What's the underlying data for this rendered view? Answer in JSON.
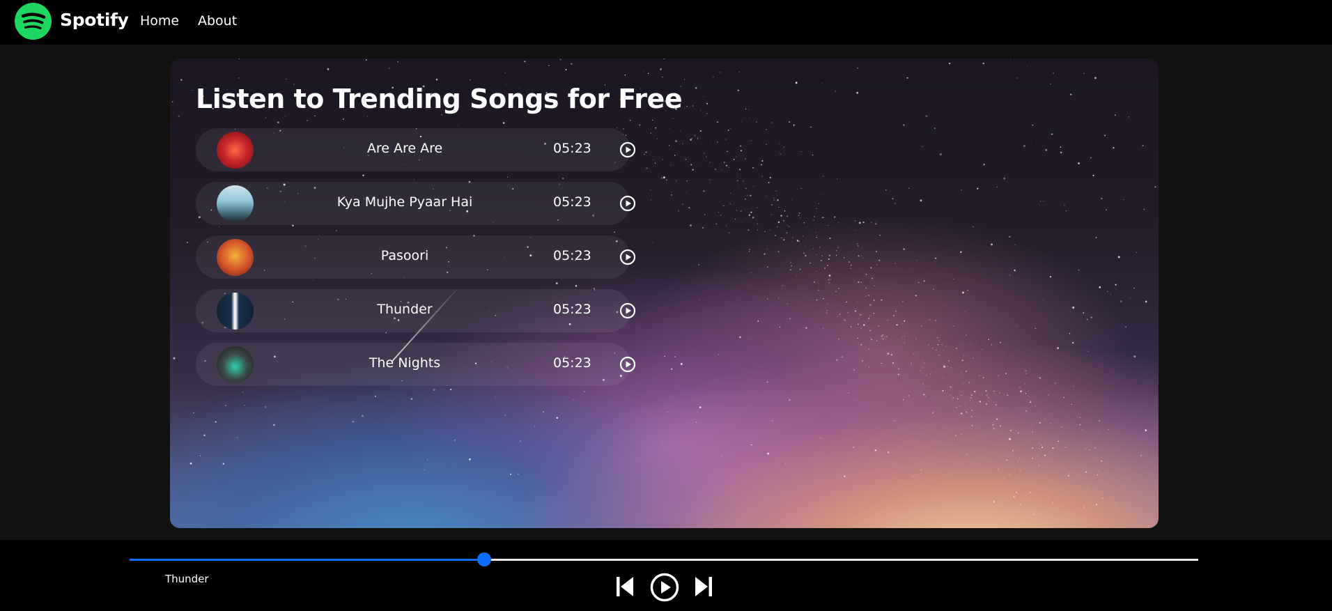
{
  "nav": {
    "brand": "Spotify",
    "links": [
      "Home",
      "About"
    ]
  },
  "hero": {
    "title": "Listen to Trending Songs for Free"
  },
  "songs": [
    {
      "name": "Are Are Are",
      "duration": "05:23",
      "cover_color": "#c8262a"
    },
    {
      "name": "Kya Mujhe Pyaar Hai",
      "duration": "05:23",
      "cover_color": "#6aa2b8"
    },
    {
      "name": "Pasoori",
      "duration": "05:23",
      "cover_color": "#d6552c"
    },
    {
      "name": "Thunder",
      "duration": "05:23",
      "cover_color": "#17314a"
    },
    {
      "name": "The Nights",
      "duration": "05:23",
      "cover_color": "#3d4a4a"
    }
  ],
  "player": {
    "now_playing": "Thunder",
    "progress_fraction": 0.332
  },
  "colors": {
    "brand_green": "#1ed760",
    "accent_blue": "#0d6efd",
    "navbar_bg": "#000000",
    "page_bg": "#121212"
  },
  "icons": {
    "logo": "spotify-logo-icon",
    "play": "play-circle-icon",
    "prev": "skip-back-icon",
    "next": "skip-forward-icon"
  }
}
